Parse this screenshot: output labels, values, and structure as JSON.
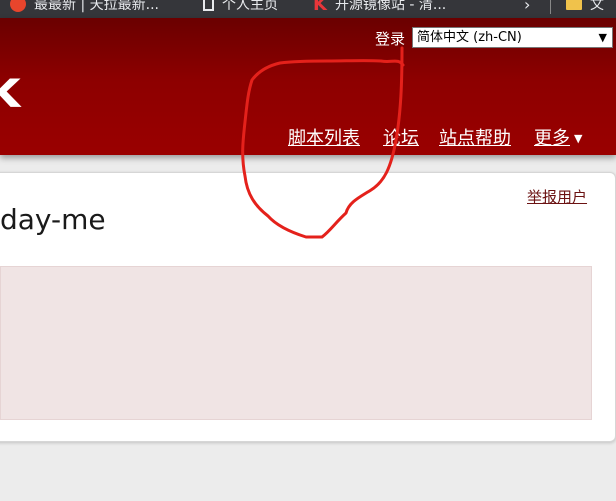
{
  "browser": {
    "bookmarks": [
      {
        "label": "最最新 | 天拉最新..."
      },
      {
        "label": "个人主页"
      },
      {
        "label": "开源镜像站 - 清..."
      }
    ],
    "overflow_label": "文"
  },
  "header": {
    "logo_fragment": "k",
    "login_label": "登录",
    "language_select": {
      "selected": "简体中文 (zh-CN)"
    },
    "nav": {
      "scripts": "脚本列表",
      "forum": "论坛",
      "help": "站点帮助",
      "more": "更多"
    }
  },
  "main": {
    "report_user": "举报用户",
    "username": "day-me"
  },
  "colors": {
    "header_top": "#6a0000",
    "header_bottom": "#9a0000",
    "annotation": "#e4211b",
    "profile_box_bg": "#f0e4e4",
    "report_link": "#6b1212"
  }
}
